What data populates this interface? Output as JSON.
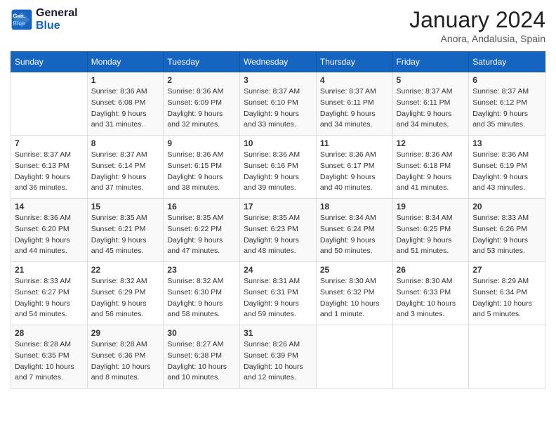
{
  "header": {
    "logo_line1": "General",
    "logo_line2": "Blue",
    "month_year": "January 2024",
    "location": "Anora, Andalusia, Spain"
  },
  "days_of_week": [
    "Sunday",
    "Monday",
    "Tuesday",
    "Wednesday",
    "Thursday",
    "Friday",
    "Saturday"
  ],
  "weeks": [
    [
      {
        "day": "",
        "info": ""
      },
      {
        "day": "1",
        "info": "Sunrise: 8:36 AM\nSunset: 6:08 PM\nDaylight: 9 hours\nand 31 minutes."
      },
      {
        "day": "2",
        "info": "Sunrise: 8:36 AM\nSunset: 6:09 PM\nDaylight: 9 hours\nand 32 minutes."
      },
      {
        "day": "3",
        "info": "Sunrise: 8:37 AM\nSunset: 6:10 PM\nDaylight: 9 hours\nand 33 minutes."
      },
      {
        "day": "4",
        "info": "Sunrise: 8:37 AM\nSunset: 6:11 PM\nDaylight: 9 hours\nand 34 minutes."
      },
      {
        "day": "5",
        "info": "Sunrise: 8:37 AM\nSunset: 6:11 PM\nDaylight: 9 hours\nand 34 minutes."
      },
      {
        "day": "6",
        "info": "Sunrise: 8:37 AM\nSunset: 6:12 PM\nDaylight: 9 hours\nand 35 minutes."
      }
    ],
    [
      {
        "day": "7",
        "info": "Sunrise: 8:37 AM\nSunset: 6:13 PM\nDaylight: 9 hours\nand 36 minutes."
      },
      {
        "day": "8",
        "info": "Sunrise: 8:37 AM\nSunset: 6:14 PM\nDaylight: 9 hours\nand 37 minutes."
      },
      {
        "day": "9",
        "info": "Sunrise: 8:36 AM\nSunset: 6:15 PM\nDaylight: 9 hours\nand 38 minutes."
      },
      {
        "day": "10",
        "info": "Sunrise: 8:36 AM\nSunset: 6:16 PM\nDaylight: 9 hours\nand 39 minutes."
      },
      {
        "day": "11",
        "info": "Sunrise: 8:36 AM\nSunset: 6:17 PM\nDaylight: 9 hours\nand 40 minutes."
      },
      {
        "day": "12",
        "info": "Sunrise: 8:36 AM\nSunset: 6:18 PM\nDaylight: 9 hours\nand 41 minutes."
      },
      {
        "day": "13",
        "info": "Sunrise: 8:36 AM\nSunset: 6:19 PM\nDaylight: 9 hours\nand 43 minutes."
      }
    ],
    [
      {
        "day": "14",
        "info": "Sunrise: 8:36 AM\nSunset: 6:20 PM\nDaylight: 9 hours\nand 44 minutes."
      },
      {
        "day": "15",
        "info": "Sunrise: 8:35 AM\nSunset: 6:21 PM\nDaylight: 9 hours\nand 45 minutes."
      },
      {
        "day": "16",
        "info": "Sunrise: 8:35 AM\nSunset: 6:22 PM\nDaylight: 9 hours\nand 47 minutes."
      },
      {
        "day": "17",
        "info": "Sunrise: 8:35 AM\nSunset: 6:23 PM\nDaylight: 9 hours\nand 48 minutes."
      },
      {
        "day": "18",
        "info": "Sunrise: 8:34 AM\nSunset: 6:24 PM\nDaylight: 9 hours\nand 50 minutes."
      },
      {
        "day": "19",
        "info": "Sunrise: 8:34 AM\nSunset: 6:25 PM\nDaylight: 9 hours\nand 51 minutes."
      },
      {
        "day": "20",
        "info": "Sunrise: 8:33 AM\nSunset: 6:26 PM\nDaylight: 9 hours\nand 53 minutes."
      }
    ],
    [
      {
        "day": "21",
        "info": "Sunrise: 8:33 AM\nSunset: 6:27 PM\nDaylight: 9 hours\nand 54 minutes."
      },
      {
        "day": "22",
        "info": "Sunrise: 8:32 AM\nSunset: 6:29 PM\nDaylight: 9 hours\nand 56 minutes."
      },
      {
        "day": "23",
        "info": "Sunrise: 8:32 AM\nSunset: 6:30 PM\nDaylight: 9 hours\nand 58 minutes."
      },
      {
        "day": "24",
        "info": "Sunrise: 8:31 AM\nSunset: 6:31 PM\nDaylight: 9 hours\nand 59 minutes."
      },
      {
        "day": "25",
        "info": "Sunrise: 8:30 AM\nSunset: 6:32 PM\nDaylight: 10 hours\nand 1 minute."
      },
      {
        "day": "26",
        "info": "Sunrise: 8:30 AM\nSunset: 6:33 PM\nDaylight: 10 hours\nand 3 minutes."
      },
      {
        "day": "27",
        "info": "Sunrise: 8:29 AM\nSunset: 6:34 PM\nDaylight: 10 hours\nand 5 minutes."
      }
    ],
    [
      {
        "day": "28",
        "info": "Sunrise: 8:28 AM\nSunset: 6:35 PM\nDaylight: 10 hours\nand 7 minutes."
      },
      {
        "day": "29",
        "info": "Sunrise: 8:28 AM\nSunset: 6:36 PM\nDaylight: 10 hours\nand 8 minutes."
      },
      {
        "day": "30",
        "info": "Sunrise: 8:27 AM\nSunset: 6:38 PM\nDaylight: 10 hours\nand 10 minutes."
      },
      {
        "day": "31",
        "info": "Sunrise: 8:26 AM\nSunset: 6:39 PM\nDaylight: 10 hours\nand 12 minutes."
      },
      {
        "day": "",
        "info": ""
      },
      {
        "day": "",
        "info": ""
      },
      {
        "day": "",
        "info": ""
      }
    ]
  ]
}
